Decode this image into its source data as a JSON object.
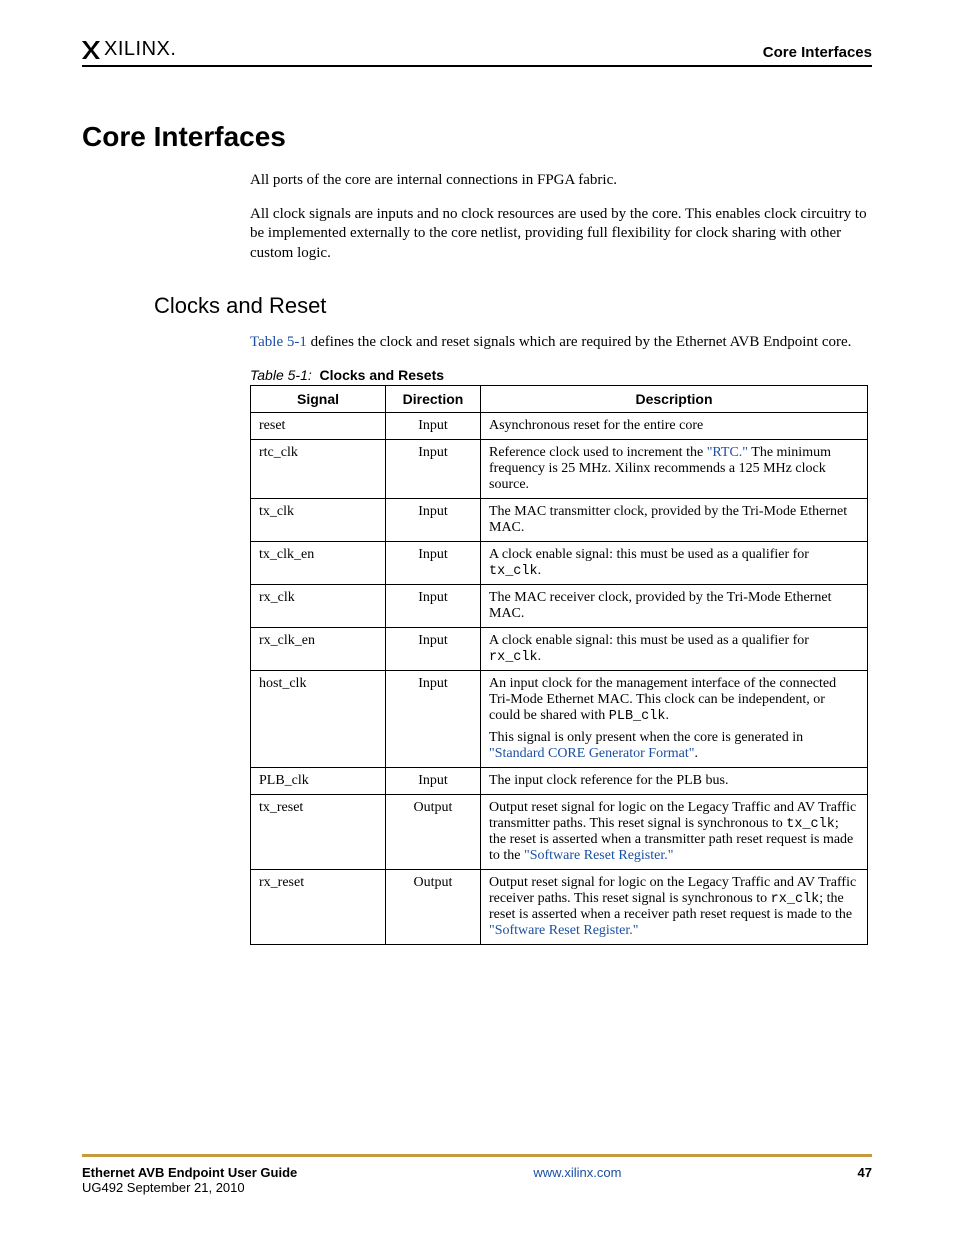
{
  "header": {
    "logo_text": "XILINX.",
    "right": "Core Interfaces"
  },
  "section": {
    "title": "Core Interfaces",
    "para1": "All ports of the core are internal connections in FPGA fabric.",
    "para2": "All clock signals are inputs and no clock resources are used by the core. This enables clock circuitry to be implemented externally to the core netlist, providing full flexibility for clock sharing with other custom logic."
  },
  "subsection": {
    "title": "Clocks and Reset",
    "intro_pre": "",
    "intro_link": "Table 5-1",
    "intro_post": " defines the clock and reset signals which are required by the Ethernet AVB Endpoint core."
  },
  "table": {
    "caption_num": "Table 5-1:",
    "caption_title": "Clocks and Resets",
    "headers": {
      "c1": "Signal",
      "c2": "Direction",
      "c3": "Description"
    },
    "rows": [
      {
        "signal": "reset",
        "direction": "Input",
        "desc": [
          {
            "t": "Asynchronous reset for the entire core"
          }
        ]
      },
      {
        "signal": "rtc_clk",
        "direction": "Input",
        "desc": [
          {
            "t": "Reference clock used to increment the "
          },
          {
            "t": "\"RTC.\"",
            "link": true
          },
          {
            "t": " The minimum frequency is 25 MHz. Xilinx recommends a 125 MHz clock source."
          }
        ]
      },
      {
        "signal": "tx_clk",
        "direction": "Input",
        "desc": [
          {
            "t": "The MAC transmitter clock, provided by the Tri-Mode Ethernet MAC."
          }
        ]
      },
      {
        "signal": "tx_clk_en",
        "direction": "Input",
        "desc": [
          {
            "t": "A clock enable signal: this must be used as a qualifier for "
          },
          {
            "t": "tx_clk",
            "mono": true
          },
          {
            "t": "."
          }
        ]
      },
      {
        "signal": "rx_clk",
        "direction": "Input",
        "desc": [
          {
            "t": "The MAC receiver clock, provided by the Tri-Mode Ethernet MAC."
          }
        ]
      },
      {
        "signal": "rx_clk_en",
        "direction": "Input",
        "desc": [
          {
            "t": "A clock enable signal: this must be used as a qualifier for "
          },
          {
            "t": "rx_clk",
            "mono": true
          },
          {
            "t": "."
          }
        ]
      },
      {
        "signal": "host_clk",
        "direction": "Input",
        "desc_multi": [
          [
            {
              "t": "An input clock for the management interface of the connected Tri-Mode Ethernet MAC. This clock can be independent, or could be shared with "
            },
            {
              "t": "PLB_clk",
              "mono": true
            },
            {
              "t": "."
            }
          ],
          [
            {
              "t": "This signal is only present when the core is generated in "
            },
            {
              "t": "\"Standard CORE Generator Format\"",
              "link": true
            },
            {
              "t": "."
            }
          ]
        ]
      },
      {
        "signal": "PLB_clk",
        "direction": "Input",
        "desc": [
          {
            "t": "The input clock reference for the PLB bus."
          }
        ]
      },
      {
        "signal": "tx_reset",
        "direction": "Output",
        "desc": [
          {
            "t": "Output reset signal for logic on the Legacy Traffic and AV Traffic transmitter paths. This reset signal is synchronous to "
          },
          {
            "t": "tx_clk",
            "mono": true
          },
          {
            "t": "; the reset is asserted when a transmitter path reset request is made to the "
          },
          {
            "t": "\"Software Reset Register.\"",
            "link": true
          }
        ]
      },
      {
        "signal": "rx_reset",
        "direction": "Output",
        "desc": [
          {
            "t": "Output reset signal for logic on the Legacy Traffic and AV Traffic receiver paths. This reset signal is synchronous to "
          },
          {
            "t": "rx_clk",
            "mono": true
          },
          {
            "t": "; the reset is asserted when a receiver path reset request is made to the "
          },
          {
            "t": "\"Software Reset Register.\"",
            "link": true
          }
        ]
      }
    ]
  },
  "footer": {
    "doc_title": "Ethernet AVB Endpoint User Guide",
    "doc_sub": "UG492 September 21, 2010",
    "url": "www.xilinx.com",
    "page": "47"
  }
}
